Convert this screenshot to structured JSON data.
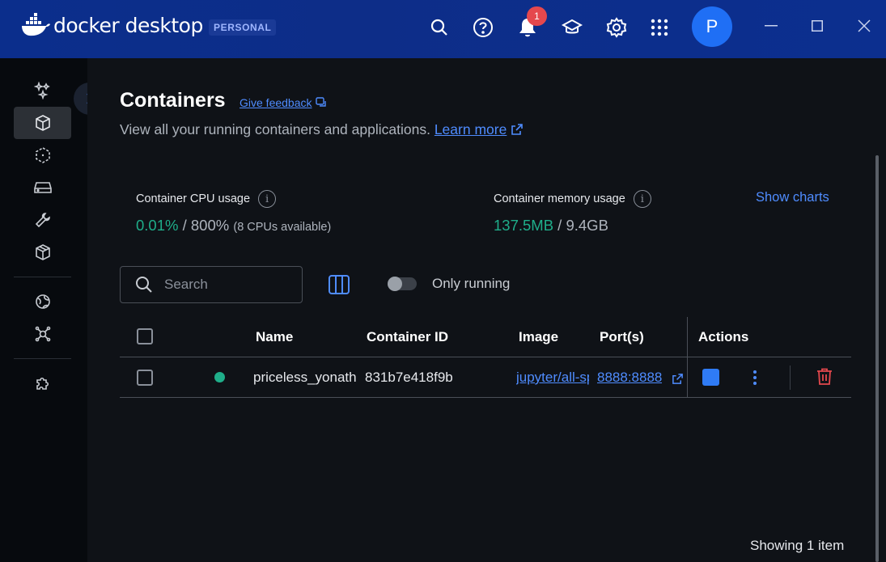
{
  "app": {
    "brand": "docker desktop",
    "plan": "PERSONAL",
    "notifications_count": "1",
    "user_initial": "P",
    "accent": "#1f6ff5"
  },
  "page": {
    "title": "Containers",
    "feedback_link": "Give feedback",
    "subtitle": "View all your running containers and applications.",
    "learn_more": "Learn more"
  },
  "stats": {
    "cpu_label": "Container CPU usage",
    "cpu_used": "0.01%",
    "cpu_total": " / 800%",
    "cpu_note": "(8 CPUs available)",
    "mem_label": "Container memory usage",
    "mem_used": "137.5MB",
    "mem_total": " / 9.4GB",
    "show_charts": "Show charts"
  },
  "toolbar": {
    "search_placeholder": "Search",
    "only_running_label": "Only running",
    "only_running_enabled": false
  },
  "table": {
    "columns": [
      "Name",
      "Container ID",
      "Image",
      "Port(s)",
      "Actions"
    ],
    "rows": [
      {
        "name": "priceless_yonath",
        "container_id": "831b7e418f9b",
        "image": "jupyter/all-spark-notebook",
        "ports": "8888:8888",
        "status": "running"
      }
    ]
  },
  "footer": {
    "count": "Showing 1 item"
  }
}
